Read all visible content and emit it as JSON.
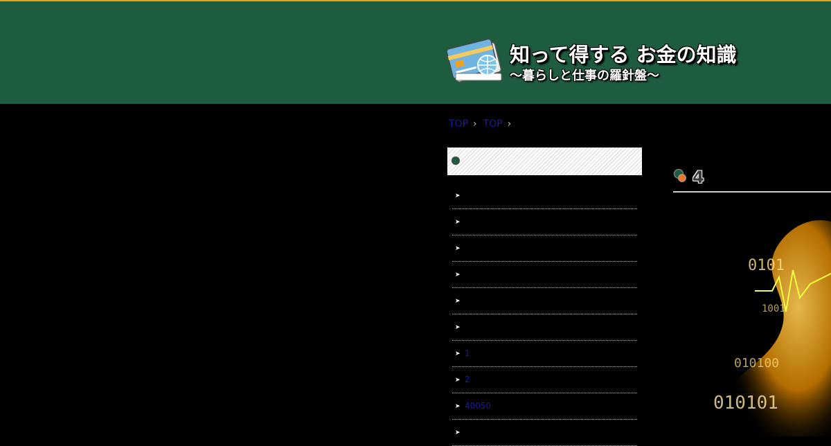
{
  "header": {
    "site_title": "知って得する お金の知識",
    "site_subtitle": "〜暮らしと仕事の羅針盤〜",
    "colors": {
      "background": "#1d5c3f",
      "top_border": "#e8a317"
    }
  },
  "breadcrumb": {
    "items": [
      {
        "label": "TOP"
      },
      {
        "label": "TOP"
      }
    ]
  },
  "sidebar": {
    "categories": [
      {
        "label": ""
      },
      {
        "label": ""
      },
      {
        "label": ""
      },
      {
        "label": ""
      },
      {
        "label": ""
      },
      {
        "label": ""
      },
      {
        "label": "1"
      },
      {
        "label": "2"
      },
      {
        "label": "40050"
      },
      {
        "label": ""
      }
    ]
  },
  "main": {
    "section_title": "4",
    "hero_image_alt": "binary-data-gold-visual"
  }
}
